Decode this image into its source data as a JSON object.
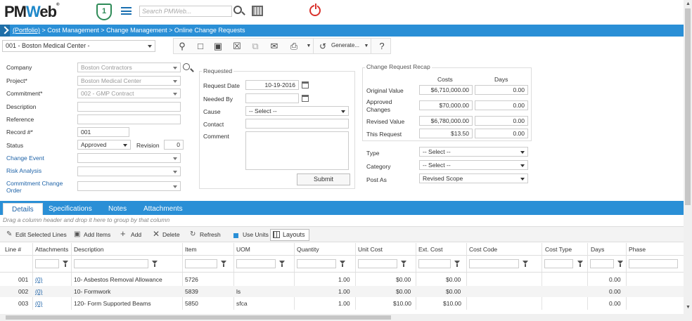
{
  "app": {
    "logo_text": "PMWeb",
    "shield_glyph": "1",
    "search_placeholder": "Search PMWeb..."
  },
  "breadcrumb": {
    "portfolio": "(Portfolio)",
    "path": " > Cost Management > Change Management > Online Change Requests"
  },
  "project_select": "001 - Boston Medical Center -",
  "toolbar": {
    "generate_label": "Generate...",
    "help_glyph": "?"
  },
  "form": {
    "company_label": "Company",
    "company_value": "Boston Contractors",
    "project_label": "Project*",
    "project_value": "Boston Medical Center",
    "commitment_label": "Commitment*",
    "commitment_value": "002 - GMP Contract",
    "description_label": "Description",
    "reference_label": "Reference",
    "record_label": "Record #*",
    "record_value": "001",
    "status_label": "Status",
    "status_value": "Approved",
    "revision_label": "Revision",
    "revision_value": "0",
    "change_event_label": "Change Event",
    "risk_analysis_label": "Risk Analysis",
    "commitment_change_order_label": "Commitment Change Order"
  },
  "requested": {
    "title": "Requested",
    "request_date_label": "Request Date",
    "request_date_value": "10-19-2016",
    "needed_by_label": "Needed By",
    "cause_label": "Cause",
    "cause_value": "-- Select --",
    "contact_label": "Contact",
    "comment_label": "Comment",
    "submit_label": "Submit"
  },
  "recap": {
    "title": "Change Request Recap",
    "costs_header": "Costs",
    "days_header": "Days",
    "rows": [
      {
        "label": "Original Value",
        "cost": "$6,710,000.00",
        "days": "0.00"
      },
      {
        "label": "Approved Changes",
        "cost": "$70,000.00",
        "days": "0.00"
      },
      {
        "label": "Revised Value",
        "cost": "$6,780,000.00",
        "days": "0.00"
      },
      {
        "label": "This Request",
        "cost": "$13.50",
        "days": "0.00"
      }
    ],
    "type_label": "Type",
    "type_value": "-- Select --",
    "category_label": "Category",
    "category_value": "-- Select --",
    "post_as_label": "Post As",
    "post_as_value": "Revised Scope"
  },
  "tabs": [
    "Details",
    "Specifications",
    "Notes",
    "Attachments"
  ],
  "drag_hint": "Drag a column header and drop it here to group by that column",
  "grid_toolbar": {
    "edit_selected": "Edit Selected Lines",
    "add_items": "Add Items",
    "add": "Add",
    "delete": "Delete",
    "refresh": "Refresh",
    "use_units": "Use Units",
    "layouts": "Layouts"
  },
  "grid": {
    "columns": [
      "Line #",
      "Attachments",
      "Description",
      "Item",
      "UOM",
      "Quantity",
      "Unit Cost",
      "Ext. Cost",
      "Cost Code",
      "Cost Type",
      "Days",
      "Phase"
    ],
    "rows": [
      {
        "line": "001",
        "att": "(0)",
        "desc": "10- Asbestos Removal Allowance",
        "item": "5726",
        "uom": "",
        "qty": "1.00",
        "unit": "$0.00",
        "ext": "$0.00",
        "days": "0.00"
      },
      {
        "line": "002",
        "att": "(0)",
        "desc": "10- Formwork",
        "item": "5839",
        "uom": "ls",
        "qty": "1.00",
        "unit": "$0.00",
        "ext": "$0.00",
        "days": "0.00"
      },
      {
        "line": "003",
        "att": "(0)",
        "desc": "120- Form Supported Beams",
        "item": "5850",
        "uom": "sfca",
        "qty": "1.00",
        "unit": "$10.00",
        "ext": "$10.00",
        "days": "0.00"
      }
    ]
  }
}
